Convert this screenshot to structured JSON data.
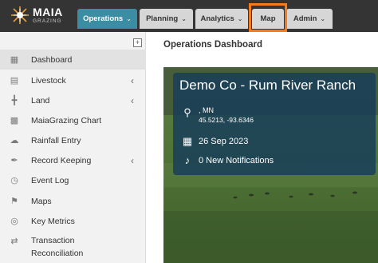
{
  "brand": {
    "name": "MAIA",
    "tagline": "GRAZING"
  },
  "nav": {
    "tabs": [
      {
        "label": "Operations",
        "has_dropdown": true,
        "active": true
      },
      {
        "label": "Planning",
        "has_dropdown": true,
        "active": false
      },
      {
        "label": "Analytics",
        "has_dropdown": true,
        "active": false
      },
      {
        "label": "Map",
        "has_dropdown": false,
        "active": false
      },
      {
        "label": "Admin",
        "has_dropdown": true,
        "active": false
      }
    ]
  },
  "sidebar": {
    "collapse_icon": "+",
    "items": [
      {
        "label": "Dashboard",
        "icon": "dashboard-icon",
        "active": true,
        "expandable": false
      },
      {
        "label": "Livestock",
        "icon": "livestock-icon",
        "active": false,
        "expandable": true
      },
      {
        "label": "Land",
        "icon": "fence-icon",
        "active": false,
        "expandable": true
      },
      {
        "label": "MaiaGrazing Chart",
        "icon": "chart-icon",
        "active": false,
        "expandable": false
      },
      {
        "label": "Rainfall Entry",
        "icon": "cloud-icon",
        "active": false,
        "expandable": false
      },
      {
        "label": "Record Keeping",
        "icon": "record-keeping-icon",
        "active": false,
        "expandable": true
      },
      {
        "label": "Event Log",
        "icon": "clock-icon",
        "active": false,
        "expandable": false
      },
      {
        "label": "Maps",
        "icon": "map-icon",
        "active": false,
        "expandable": false
      },
      {
        "label": "Key Metrics",
        "icon": "target-icon",
        "active": false,
        "expandable": false
      },
      {
        "label_line1": "Transaction",
        "label_line2": "Reconciliation",
        "icon": "transfer-icon",
        "active": false,
        "expandable": false
      }
    ]
  },
  "main": {
    "title": "Operations Dashboard",
    "card": {
      "title": "Demo Co - Rum River Ranch",
      "location_name": ", MN",
      "coordinates": "45.5213, -93.6346",
      "date": "26 Sep 2023",
      "notifications": "0 New Notifications"
    }
  },
  "colors": {
    "topbar": "#343434",
    "active_tab": "#3a8da3",
    "highlight": "#f47c20",
    "card_overlay": "#163c5a"
  }
}
